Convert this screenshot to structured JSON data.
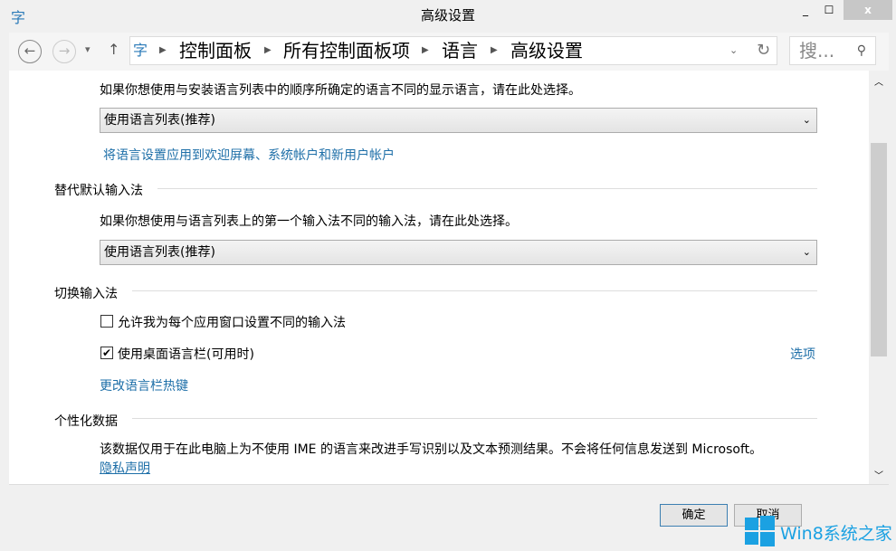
{
  "window": {
    "title": "高级设置",
    "minimize": "_",
    "maximize": "☐",
    "close": "x"
  },
  "nav": {
    "back": "←",
    "forward": "→",
    "dropdown": "▾",
    "up": "↑",
    "breadcrumb": [
      "控制面板",
      "所有控制面板项",
      "语言",
      "高级设置"
    ],
    "search_placeholder": "搜...",
    "refresh": "↻"
  },
  "sections": {
    "display_desc": "如果你想使用与安装语言列表中的顺序所确定的语言不同的显示语言，请在此处选择。",
    "display_select": "使用语言列表(推荐)",
    "apply_link": "将语言设置应用到欢迎屏幕、系统帐户和新用户帐户",
    "input_heading": "替代默认输入法",
    "input_desc": "如果你想使用与语言列表上的第一个输入法不同的输入法，请在此处选择。",
    "input_select": "使用语言列表(推荐)",
    "switch_heading": "切换输入法",
    "cb1_label": "允许我为每个应用窗口设置不同的输入法",
    "cb1_checked": false,
    "cb2_label": "使用桌面语言栏(可用时)",
    "cb2_checked": true,
    "options_link": "选项",
    "hotkey_link": "更改语言栏热键",
    "personal_heading": "个性化数据",
    "personal_desc": "该数据仅用于在此电脑上为不使用 IME 的语言来改进手写识别以及文本预测结果。不会将任何信息发送到 Microsoft。",
    "privacy_link": "隐私声明"
  },
  "footer": {
    "ok": "确定",
    "cancel": "取消"
  },
  "watermark": "Win8系统之家"
}
